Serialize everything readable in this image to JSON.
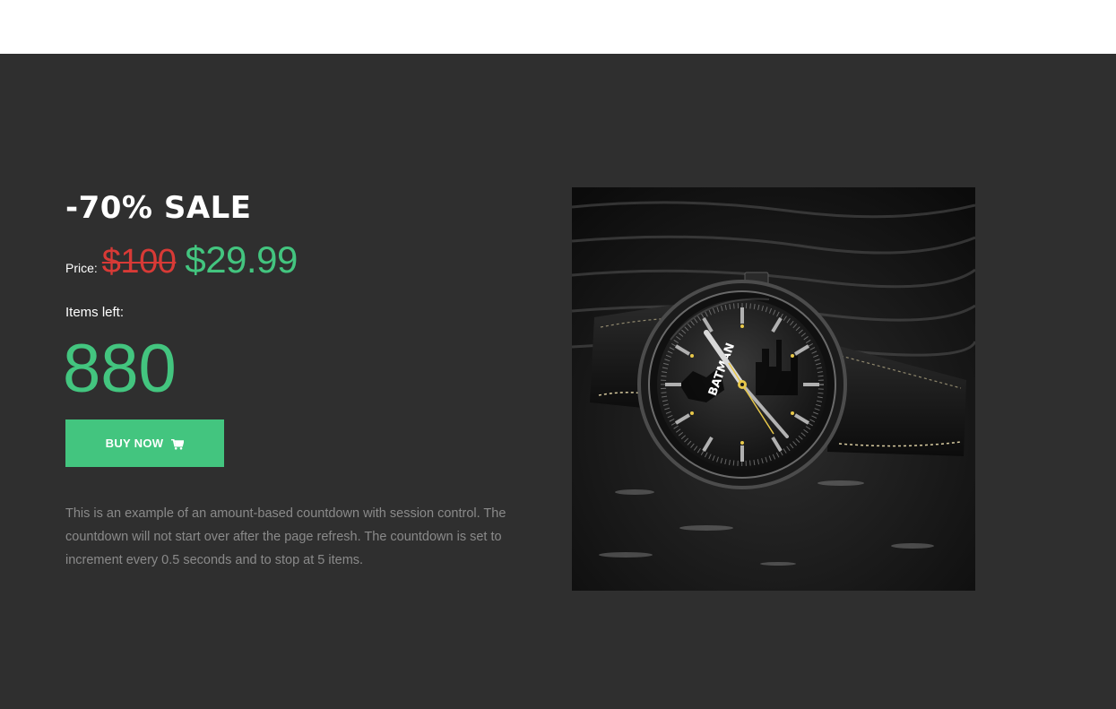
{
  "promo": {
    "title": "-70% SALE",
    "price_label": "Price:",
    "old_price": "$100",
    "new_price": "$29.99",
    "items_label": "Items left:",
    "items_count": "880",
    "buy_button_label": "BUY NOW",
    "buy_button_icon": "cart-icon",
    "description": "This is an example of an amount-based countdown with session control. The countdown will not start over after the page refresh. The countdown is set to increment every 0.5 seconds and to stop at 5 items."
  },
  "product_image": {
    "watch_dial_text": "BATMAN"
  },
  "colors": {
    "background": "#2f2f2f",
    "accent_green": "#43c57f",
    "old_price_red": "#d83a36"
  }
}
